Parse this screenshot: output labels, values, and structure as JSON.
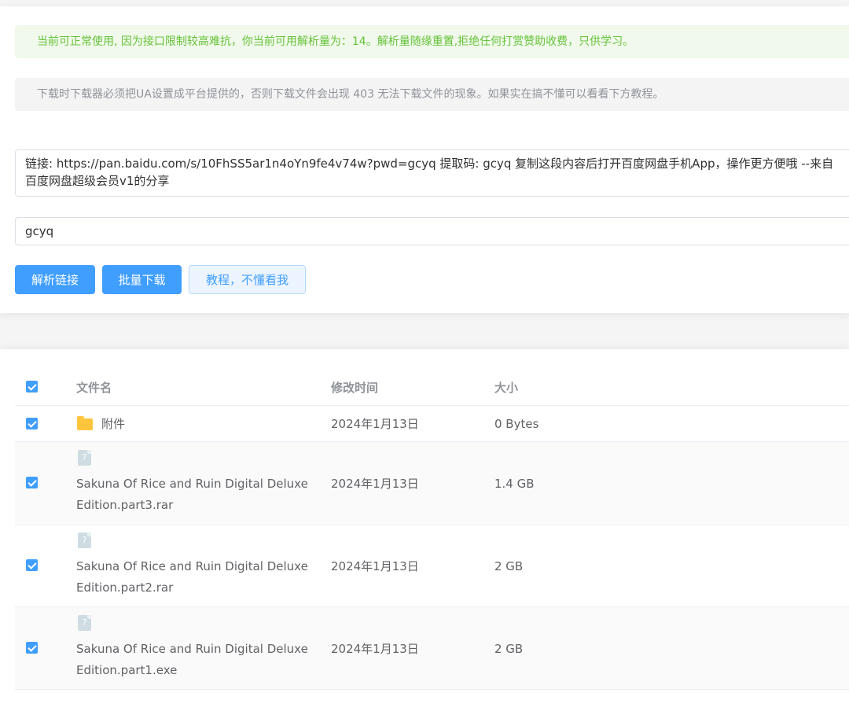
{
  "alerts": {
    "success": "当前可正常使用, 因为接口限制较高难抗，你当前可用解析量为：14。解析量随缘重置,拒绝任何打赏赞助收费，只供学习。",
    "info": "下载时下载器必须把UA设置成平台提供的，否则下载文件会出现 403 无法下载文件的现象。如果实在搞不懂可以看看下方教程。"
  },
  "form": {
    "link_value": "链接: https://pan.baidu.com/s/10FhSS5ar1n4oYn9fe4v74w?pwd=gcyq 提取码: gcyq 复制这段内容后打开百度网盘手机App，操作更方便哦 --来自百度网盘超级会员v1的分享",
    "code_value": "gcyq"
  },
  "buttons": {
    "parse": "解析链接",
    "batch_download": "批量下载",
    "tutorial": "教程，不懂看我"
  },
  "table": {
    "headers": {
      "name": "文件名",
      "time": "修改时间",
      "size": "大小"
    },
    "rows": [
      {
        "type": "folder",
        "name": "附件",
        "time": "2024年1月13日",
        "size": "0 Bytes",
        "checked": true
      },
      {
        "type": "file",
        "name": "Sakuna Of Rice and Ruin Digital Deluxe Edition.part3.rar",
        "time": "2024年1月13日",
        "size": "1.4 GB",
        "checked": true
      },
      {
        "type": "file",
        "name": "Sakuna Of Rice and Ruin Digital Deluxe Edition.part2.rar",
        "time": "2024年1月13日",
        "size": "2 GB",
        "checked": true
      },
      {
        "type": "file",
        "name": "Sakuna Of Rice and Ruin Digital Deluxe Edition.part1.exe",
        "time": "2024年1月13日",
        "size": "2 GB",
        "checked": true
      }
    ]
  },
  "icons": {
    "folder": "folder-icon",
    "file": "unknown-file-icon",
    "file_glyph": "?"
  },
  "colors": {
    "primary": "#409eff",
    "success": "#67c23a",
    "folder": "#ffc53d"
  }
}
